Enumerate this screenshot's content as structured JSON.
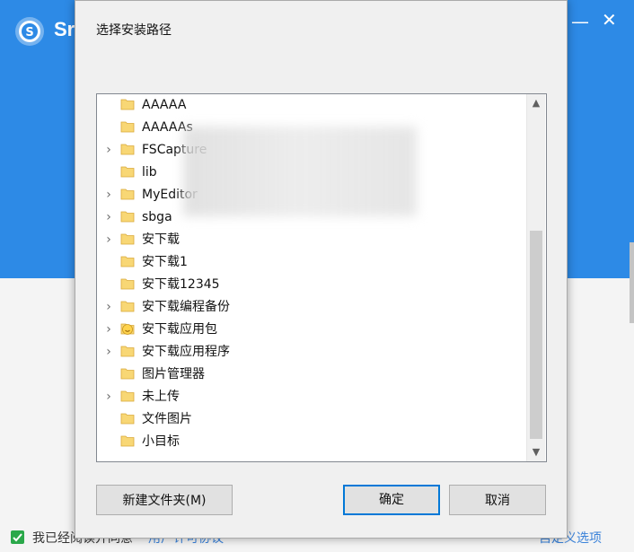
{
  "background_app": {
    "title": "Sr",
    "minimize_glyph": "—",
    "close_glyph": "✕",
    "agree_text": "我已经阅读并同意",
    "license_link": "用户许可协议",
    "custom_link": "自定义选项",
    "accent_color": "#2d8ae6"
  },
  "dialog": {
    "title": "选择安装路径",
    "tree": [
      {
        "label": "AAAAA",
        "expandable": false,
        "icon": "folder-icon"
      },
      {
        "label": "AAAAAs",
        "expandable": false,
        "icon": "folder-icon"
      },
      {
        "label": "FSCapture",
        "expandable": true,
        "icon": "folder-icon"
      },
      {
        "label": "lib",
        "expandable": false,
        "icon": "folder-icon"
      },
      {
        "label": "MyEditor",
        "expandable": true,
        "icon": "folder-icon"
      },
      {
        "label": "sbga",
        "expandable": true,
        "icon": "folder-icon"
      },
      {
        "label": "安下载",
        "expandable": true,
        "icon": "folder-icon"
      },
      {
        "label": "安下载1",
        "expandable": false,
        "icon": "folder-icon"
      },
      {
        "label": "安下载12345",
        "expandable": false,
        "icon": "folder-icon"
      },
      {
        "label": "安下载编程备份",
        "expandable": true,
        "icon": "folder-icon"
      },
      {
        "label": "安下载应用包",
        "expandable": true,
        "icon": "smiley-folder-icon"
      },
      {
        "label": "安下载应用程序",
        "expandable": true,
        "icon": "folder-icon"
      },
      {
        "label": "图片管理器",
        "expandable": false,
        "icon": "folder-icon"
      },
      {
        "label": "未上传",
        "expandable": true,
        "icon": "folder-icon"
      },
      {
        "label": "文件图片",
        "expandable": false,
        "icon": "folder-icon"
      },
      {
        "label": "小目标",
        "expandable": false,
        "icon": "folder-icon"
      }
    ],
    "buttons": {
      "new_folder": "新建文件夹(M)",
      "ok": "确定",
      "cancel": "取消"
    }
  }
}
